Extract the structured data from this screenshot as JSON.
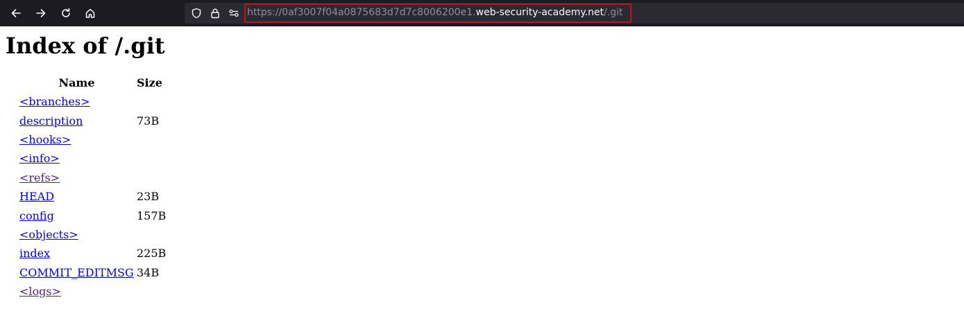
{
  "browser": {
    "nav": {
      "back_icon": "arrow-left-icon",
      "forward_icon": "arrow-right-icon",
      "reload_icon": "reload-icon",
      "home_icon": "home-icon"
    },
    "urlbar": {
      "icons": [
        "shield-icon",
        "lock-icon",
        "permissions-icon"
      ],
      "url_prefix": "https://0af3007f04a0875683d7d7c8006200e1.",
      "url_domain": "web-security-academy.net",
      "url_path": "/.git",
      "highlight_color": "#c1121f"
    }
  },
  "page": {
    "title": "Index of /.git",
    "columns": {
      "name": "Name",
      "size": "Size"
    },
    "entries": [
      {
        "name": "<branches>",
        "size": "",
        "visited": false
      },
      {
        "name": "description",
        "size": "73B",
        "visited": false
      },
      {
        "name": "<hooks>",
        "size": "",
        "visited": false
      },
      {
        "name": "<info>",
        "size": "",
        "visited": false
      },
      {
        "name": "<refs>",
        "size": "",
        "visited": true
      },
      {
        "name": "HEAD",
        "size": "23B",
        "visited": false
      },
      {
        "name": "config",
        "size": "157B",
        "visited": false
      },
      {
        "name": "<objects>",
        "size": "",
        "visited": false
      },
      {
        "name": "index",
        "size": "225B",
        "visited": false
      },
      {
        "name": "COMMIT_EDITMSG",
        "size": "34B",
        "visited": false
      },
      {
        "name": "<logs>",
        "size": "",
        "visited": true
      }
    ],
    "link_color": "#0000ee",
    "visited_color": "#551a8b"
  }
}
